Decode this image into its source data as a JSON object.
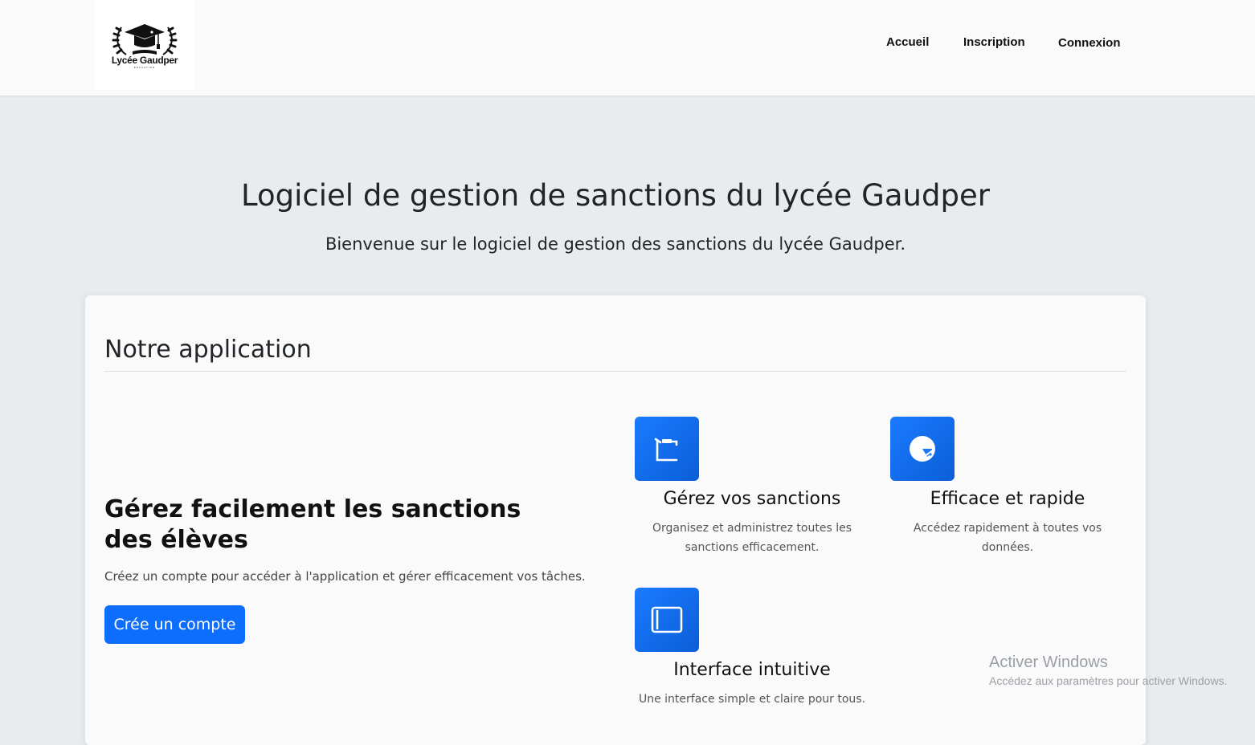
{
  "navbar": {
    "logo": {
      "name": "Lycée Gaudper",
      "tagline": "EDUCATION"
    },
    "links": [
      {
        "label": "Accueil"
      },
      {
        "label": "Inscription"
      },
      {
        "label": "Connexion"
      }
    ]
  },
  "hero": {
    "title": "Logiciel de gestion de sanctions du lycée Gaudper",
    "subtitle": "Bienvenue sur le logiciel de gestion des sanctions du lycée Gaudper."
  },
  "section": {
    "title": "Notre application",
    "lead_title": "Gérez facilement les sanctions des élèves",
    "lead_text": "Créez un compte pour accéder à l'application et gérer efficacement vos tâches.",
    "cta_label": "Crée un compte"
  },
  "features": [
    {
      "icon": "clipboard-icon",
      "title": "Gérez vos sanctions",
      "description": "Organisez et administrez toutes les sanctions efficacement."
    },
    {
      "icon": "speedometer-icon",
      "title": "Efficace et rapide",
      "description": "Accédez rapidement à toutes vos données."
    },
    {
      "icon": "window-icon",
      "title": "Interface intuitive",
      "description": "Une interface simple et claire pour tous."
    }
  ],
  "watermark": {
    "title": "Activer Windows",
    "subtitle": "Accédez aux paramètres pour activer Windows."
  },
  "colors": {
    "primary": "#0d6efd",
    "page_background": "#e9ecef",
    "card_background": "#fafafa"
  }
}
